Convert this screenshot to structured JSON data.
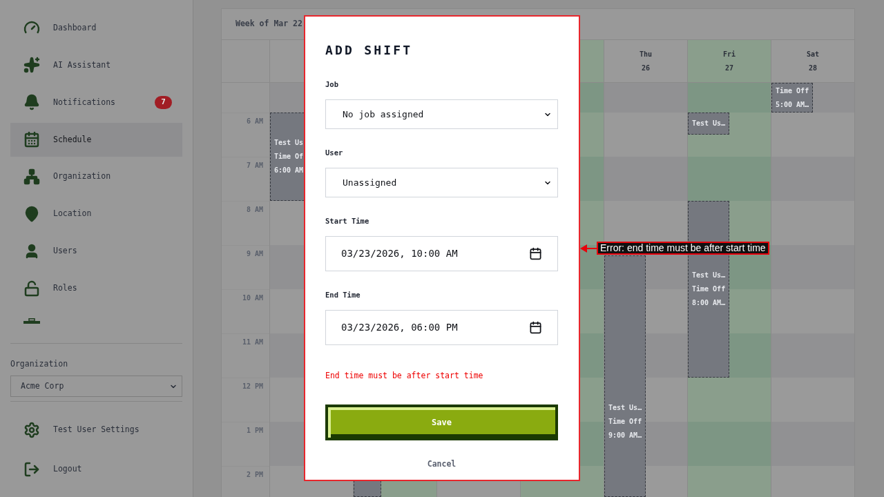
{
  "sidebar": {
    "items": [
      {
        "label": "Dashboard",
        "selected": false
      },
      {
        "label": "AI Assistant",
        "selected": false
      },
      {
        "label": "Notifications",
        "selected": false,
        "badge": "7"
      },
      {
        "label": "Schedule",
        "selected": true
      },
      {
        "label": "Organization",
        "selected": false
      },
      {
        "label": "Location",
        "selected": false
      },
      {
        "label": "Users",
        "selected": false
      },
      {
        "label": "Roles",
        "selected": false
      }
    ],
    "organization": {
      "label": "Organization",
      "value": "Acme Corp"
    },
    "footer_items": [
      {
        "label": "Test User Settings"
      },
      {
        "label": "Logout"
      }
    ]
  },
  "calendar": {
    "title": "Week of Mar 22",
    "hours": [
      "6 AM",
      "7 AM",
      "8 AM",
      "9 AM",
      "10 AM",
      "11 AM",
      "12 PM",
      "1 PM",
      "2 PM"
    ],
    "columns": {
      "column_1": {
        "highlighted": false,
        "events": [
          {
            "kind": "labelled",
            "lines": [
              "Test Us",
              "Time Of",
              "6:00 AM"
            ]
          }
        ]
      },
      "column_2": {
        "highlighted": true,
        "events": [
          {
            "kind": "bare"
          }
        ]
      },
      "column_4": {
        "highlighted": true
      },
      "column_5": {
        "label": "Thu",
        "date": "26",
        "highlighted": false,
        "events": [
          {
            "kind": "labelled",
            "lines": [
              "Test Us…",
              "Time Off",
              "9:00 AM…"
            ]
          }
        ]
      },
      "column_6": {
        "label": "Fri",
        "date": "27",
        "highlighted": true,
        "events": [
          {
            "kind": "labelled",
            "lines": [
              "Test Us…"
            ]
          },
          {
            "kind": "labelled",
            "lines": [
              "Test Us…",
              "Time Off",
              "8:00 AM…"
            ]
          }
        ]
      },
      "column_7": {
        "label": "Sat",
        "date": "28",
        "highlighted": false,
        "events": [
          {
            "kind": "labelled",
            "lines": [
              "Time Off",
              "5:00 AM…"
            ]
          }
        ]
      }
    }
  },
  "dialog": {
    "title": "ADD SHIFT",
    "fields": [
      {
        "kind": "select",
        "label": "Job",
        "value": "No job assigned"
      },
      {
        "kind": "select",
        "label": "User",
        "value": "Unassigned"
      },
      {
        "kind": "datetime",
        "label": "Start Time",
        "value": "03/23/2026, 10:00 AM"
      },
      {
        "kind": "datetime",
        "label": "End Time",
        "value": "03/23/2026, 06:00 PM"
      }
    ],
    "error": "End time must be after start time",
    "buttons": [
      {
        "kind": "primary",
        "label": "Save"
      },
      {
        "kind": "link",
        "label": "Cancel"
      }
    ]
  },
  "annotation": {
    "text": "Error: end time must be after start time",
    "outlines_dialog": true
  }
}
